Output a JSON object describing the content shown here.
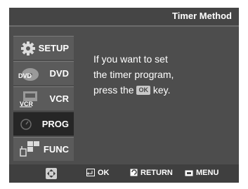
{
  "header": {
    "title": "Timer Method"
  },
  "sidebar": {
    "items": [
      {
        "label": "SETUP",
        "icon": "gear-icon",
        "active": false
      },
      {
        "label": "DVD",
        "icon": "dvd-icon",
        "icon_text": "DVD",
        "active": false
      },
      {
        "label": "VCR",
        "icon": "vcr-icon",
        "icon_text": "VCR",
        "active": false
      },
      {
        "label": "PROG",
        "icon": "clock-icon",
        "active": true
      },
      {
        "label": "FUNC",
        "icon": "function-icon",
        "active": false
      }
    ]
  },
  "message": {
    "line1": "If you want to set",
    "line2": "the timer program,",
    "line3_prefix": "press the",
    "ok_badge": "OK",
    "line3_suffix": "key."
  },
  "footer": {
    "nav_icon": "directional-pad-icon",
    "ok_label": "OK",
    "return_label": "RETURN",
    "menu_label": "MENU"
  },
  "colors": {
    "screen_bg": "#4d4d4d",
    "sidebar_item_bg": "#5b5b5b",
    "sidebar_active_bg": "#262626",
    "footer_bg": "#3f3f3f",
    "text": "#ffffff"
  }
}
